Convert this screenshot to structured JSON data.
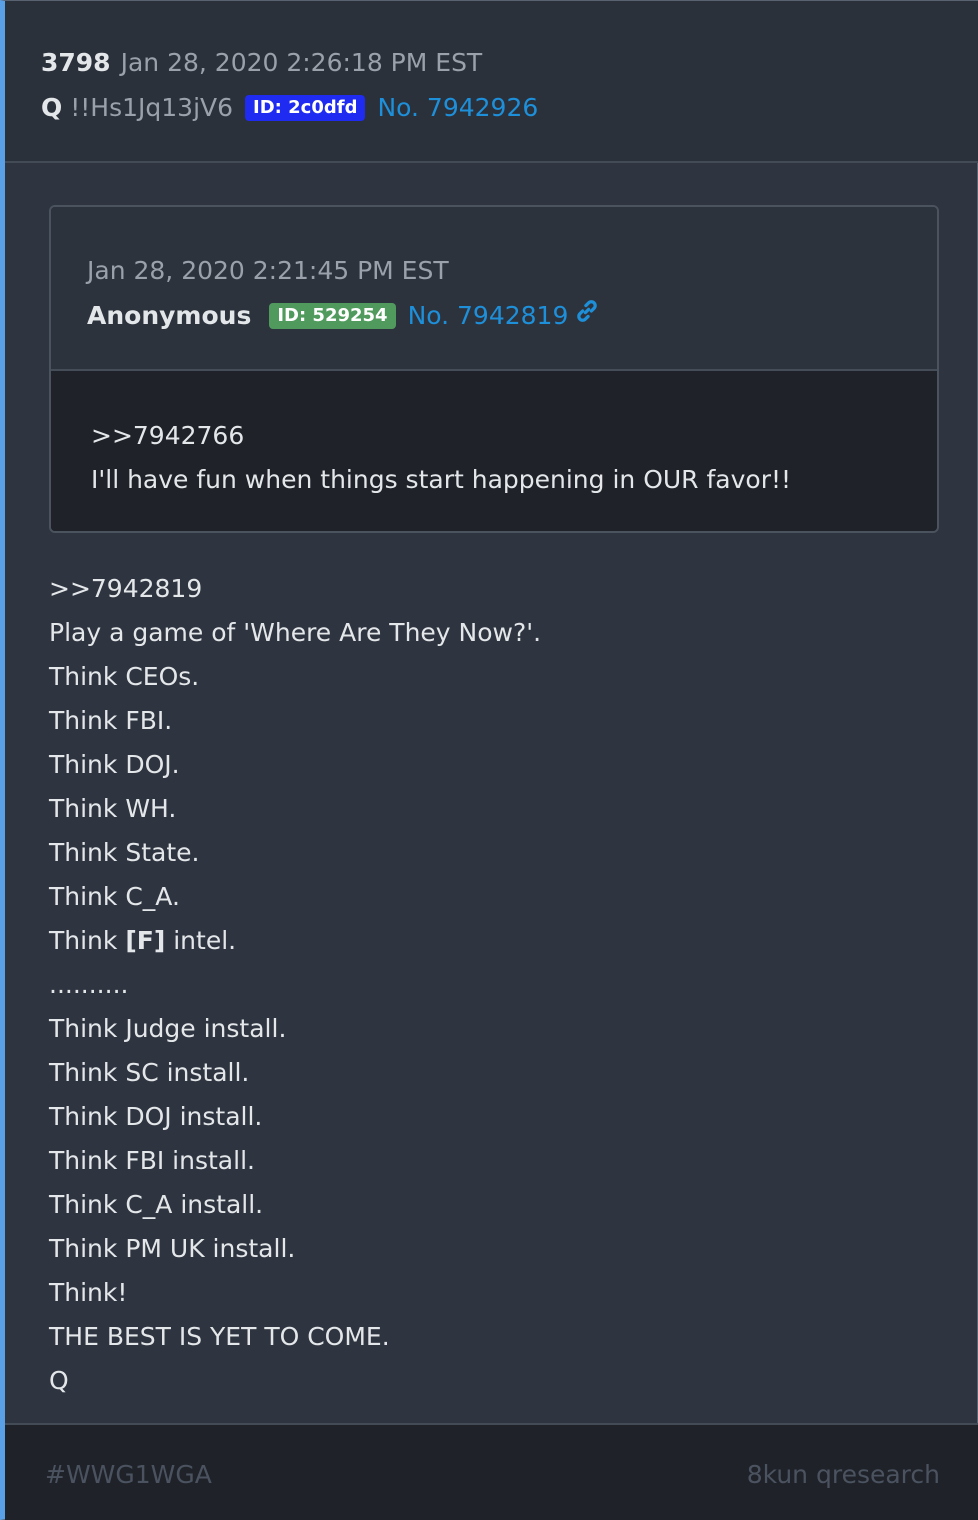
{
  "post": {
    "number": "3798",
    "date": "Jan 28, 2020 2:26:18 PM EST",
    "author": "Q",
    "tripcode": "!!Hs1Jq13jV6",
    "id_badge": "ID: 2c0dfd",
    "post_no": "No. 7942926"
  },
  "quoted": {
    "date": "Jan 28, 2020 2:21:45 PM EST",
    "author": "Anonymous",
    "id_badge": "ID: 529254",
    "post_no": "No. 7942819",
    "link_icon": "link-icon",
    "lines": [
      ">>7942766",
      "I'll have fun when things start happening in OUR favor!!"
    ]
  },
  "body": {
    "lines": [
      ">>7942819",
      "Play a game of 'Where Are They Now?'.",
      "Think CEOs.",
      "Think FBI.",
      "Think DOJ.",
      "Think WH.",
      "Think State.",
      "Think C_A.",
      {
        "prefix": "Think ",
        "bold": "[F]",
        "suffix": " intel."
      },
      "..........",
      "Think Judge install.",
      "Think SC install.",
      "Think DOJ install.",
      "Think FBI install.",
      "Think C_A install.",
      "Think PM UK install.",
      "Think!",
      "THE BEST IS YET TO COME.",
      "Q"
    ]
  },
  "footer": {
    "hashtag": "#WWG1WGA",
    "source": "8kun qresearch"
  },
  "colors": {
    "accent": "#5aa0e6",
    "link": "#1e8fd9",
    "id_blue": "#1f2bf0",
    "id_green": "#4f9a5c"
  }
}
